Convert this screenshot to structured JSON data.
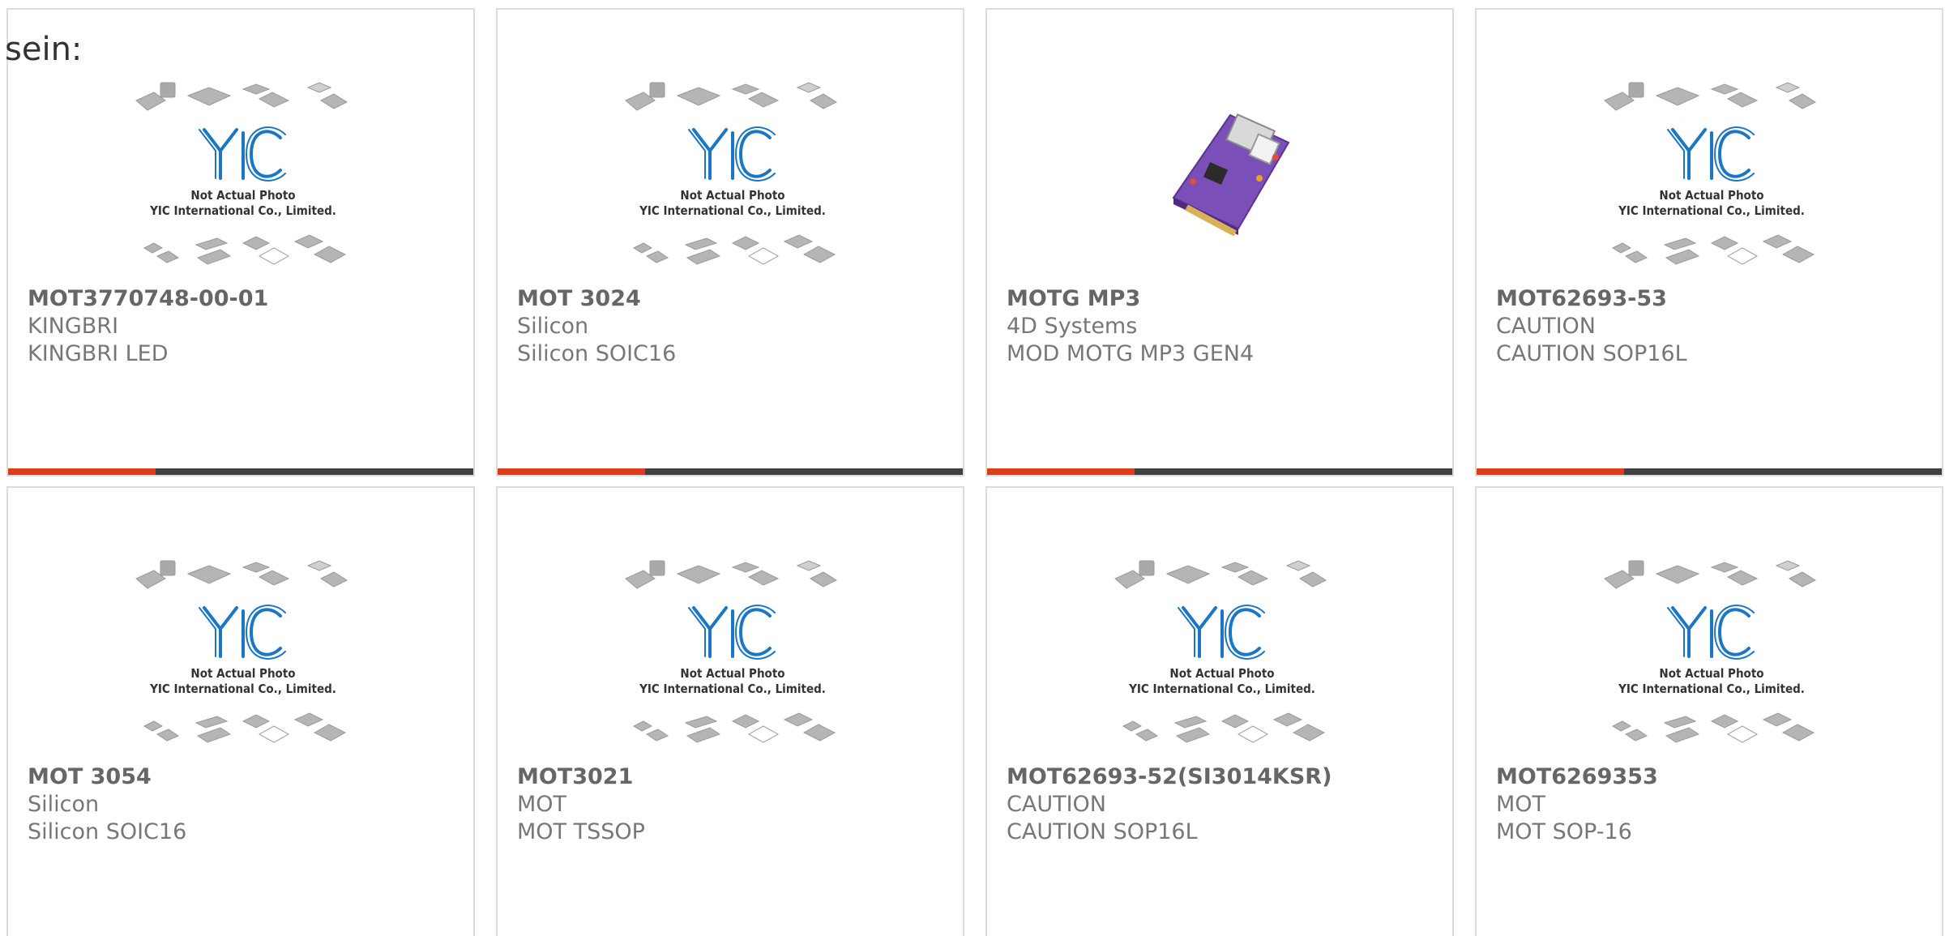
{
  "intro_text": "sein:",
  "placeholder": {
    "caption_line1": "Not Actual Photo",
    "caption_line2": "YIC International Co., Limited."
  },
  "colors": {
    "accent": "#e03a1a",
    "bar": "#404040",
    "logo": "#1b77c6",
    "border": "#dcdcdc"
  },
  "products": [
    {
      "part_number": "MOT3770748-00-01",
      "manufacturer": "KINGBRI",
      "description": "KINGBRI LED",
      "image": "placeholder"
    },
    {
      "part_number": "MOT 3024",
      "manufacturer": "Silicon",
      "description": "Silicon SOIC16",
      "image": "placeholder"
    },
    {
      "part_number": "MOTG MP3",
      "manufacturer": "4D Systems",
      "description": "MOD MOTG MP3 GEN4",
      "image": "purple-module-board"
    },
    {
      "part_number": "MOT62693-53",
      "manufacturer": "CAUTION",
      "description": "CAUTION SOP16L",
      "image": "placeholder"
    },
    {
      "part_number": "MOT 3054",
      "manufacturer": "Silicon",
      "description": "Silicon SOIC16",
      "image": "placeholder"
    },
    {
      "part_number": "MOT3021",
      "manufacturer": "MOT",
      "description": "MOT TSSOP",
      "image": "placeholder"
    },
    {
      "part_number": "MOT62693-52(SI3014KSR)",
      "manufacturer": "CAUTION",
      "description": "CAUTION SOP16L",
      "image": "placeholder"
    },
    {
      "part_number": "MOT6269353",
      "manufacturer": "MOT",
      "description": "MOT SOP-16",
      "image": "placeholder"
    }
  ]
}
